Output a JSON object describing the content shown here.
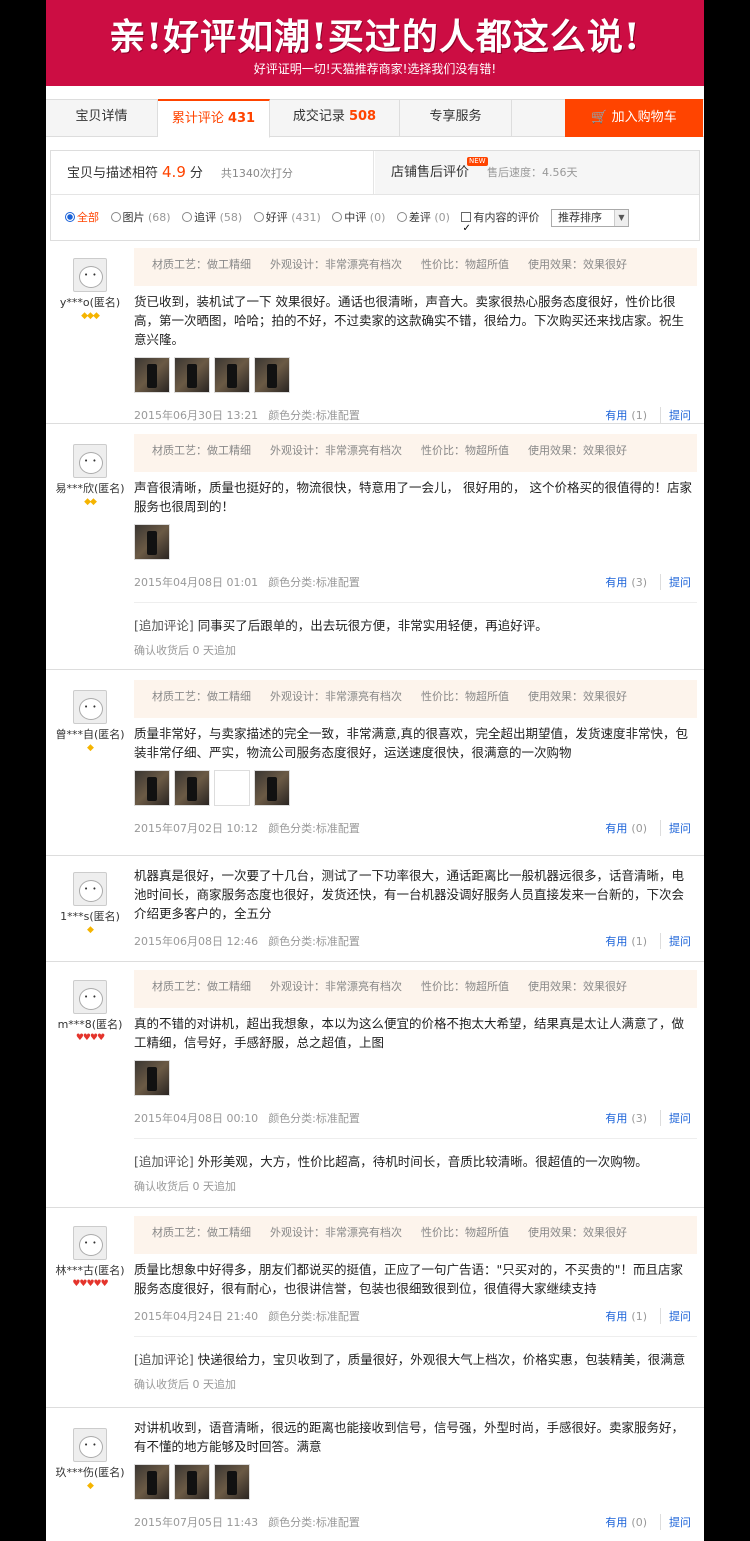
{
  "banner": {
    "title": "亲!好评如潮!买过的人都这么说!",
    "subtitle": "好评证明一切!天猫推荐商家!选择我们没有错!"
  },
  "tabs": [
    {
      "label": "宝贝详情",
      "count": ""
    },
    {
      "label": "累计评论",
      "count": "431"
    },
    {
      "label": "成交记录",
      "count": "508"
    },
    {
      "label": "专享服务",
      "count": ""
    }
  ],
  "cart_button": "加入购物车",
  "summary": {
    "match_label": "宝贝与描述相符",
    "score": "4.9",
    "unit": "分",
    "total": "共1340次打分",
    "after_sale_label": "店铺售后评价",
    "new_badge": "NEW",
    "speed": "售后速度：4.56天"
  },
  "filters": [
    {
      "label": "全部",
      "count": ""
    },
    {
      "label": "图片",
      "count": "(68)"
    },
    {
      "label": "追评",
      "count": "(58)"
    },
    {
      "label": "好评",
      "count": "(431)"
    },
    {
      "label": "中评",
      "count": "(0)"
    },
    {
      "label": "差评",
      "count": "(0)"
    }
  ],
  "content_filter": "有内容的评价",
  "sort": "推荐排序",
  "tag_labels": {
    "t1": "材质工艺：做工精细",
    "t2": "外观设计：非常漂亮有档次",
    "t3": "性价比：物超所值",
    "t4": "使用效果：效果很好"
  },
  "useful_label": "有用",
  "reply_label": "提问",
  "reviews": [
    {
      "user": "y***o(匿名)",
      "level": "◆◆◆",
      "content": "货已收到，装机试了一下 效果很好。通话也很清晰，声音大。卖家很热心服务态度很好，性价比很高，第一次晒图，哈哈；拍的不好，不过卖家的这款确实不错，很给力。下次购买还来找店家。祝生意兴隆。",
      "date": "2015年06月30日 13:21",
      "color": "颜色分类:标准配置",
      "useful": "(1)"
    },
    {
      "user": "易***欣(匿名)",
      "level": "◆◆",
      "content": "声音很清晰，质量也挺好的，物流很快，特意用了一会儿， 很好用的， 这个价格买的很值得的！店家服务也很周到的！",
      "date": "2015年04月08日 01:01",
      "color": "颜色分类:标准配置",
      "useful": "(3)",
      "append_prefix": "[追加评论]",
      "append": " 同事买了后跟单的，出去玩很方便，非常实用轻便，再追好评。",
      "append_meta": "确认收货后 0 天追加"
    },
    {
      "user": "曾***自(匿名)",
      "level": "◆",
      "content": "质量非常好，与卖家描述的完全一致，非常满意,真的很喜欢，完全超出期望值，发货速度非常快，包装非常仔细、严实，物流公司服务态度很好，运送速度很快，很满意的一次购物",
      "date": "2015年07月02日 10:12",
      "color": "颜色分类:标准配置",
      "useful": "(0)"
    },
    {
      "user": "1***s(匿名)",
      "level": "◆",
      "content": "机器真是很好，一次要了十几台，测试了一下功率很大，通话距离比一般机器远很多，话音清晰，电池时间长，商家服务态度也很好，发货还快，有一台机器没调好服务人员直接发来一台新的，下次会介绍更多客户的，全五分",
      "date": "2015年06月08日 12:46",
      "color": "颜色分类:标准配置",
      "useful": "(1)"
    },
    {
      "user": "m***8(匿名)",
      "level": "♥♥♥♥",
      "content": "真的不错的对讲机，超出我想象，本以为这么便宜的价格不抱太大希望，结果真是太让人满意了，做工精细，信号好，手感舒服，总之超值，上图",
      "date": "2015年04月08日 00:10",
      "color": "颜色分类:标准配置",
      "useful": "(3)",
      "append_prefix": "[追加评论]",
      "append": " 外形美观，大方，性价比超高，待机时间长，音质比较清晰。很超值的一次购物。",
      "append_meta": "确认收货后 0 天追加"
    },
    {
      "user": "林***古(匿名)",
      "level": "♥♥♥♥♥",
      "content": "质量比想象中好得多，朋友们都说买的挺值，正应了一句广告语：\"只买对的，不买贵的\"！而且店家服务态度很好，很有耐心，也很讲信誉，包装也很细致很到位，很值得大家继续支持",
      "date": "2015年04月24日 21:40",
      "color": "颜色分类:标准配置",
      "useful": "(1)",
      "append_prefix": "[追加评论]",
      "append": " 快递很给力，宝贝收到了，质量很好，外观很大气上档次，价格实惠，包装精美，很满意",
      "append_meta": "确认收货后 0 天追加"
    },
    {
      "user": "玖***伤(匿名)",
      "level": "◆",
      "content": "对讲机收到，语音清晰，很远的距离也能接收到信号，信号强，外型时尚，手感很好。卖家服务好，有不懂的地方能够及时回答。满意",
      "date": "2015年07月05日 11:43",
      "color": "颜色分类:标准配置",
      "useful": "(0)"
    }
  ]
}
